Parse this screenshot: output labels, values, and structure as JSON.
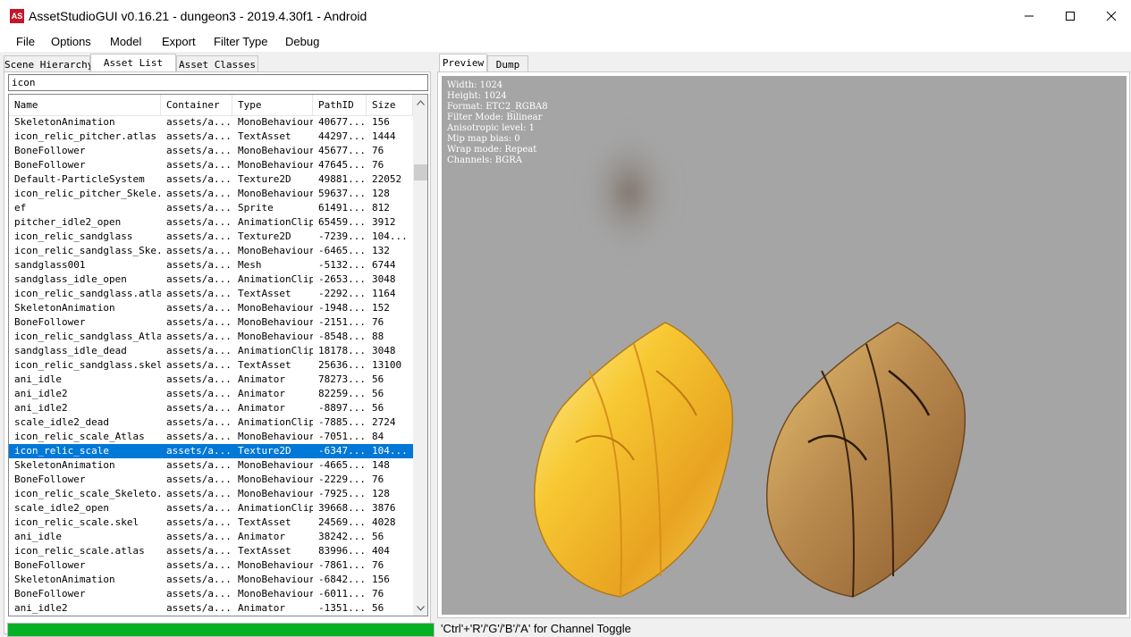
{
  "window": {
    "title": "AssetStudioGUI v0.16.21 - dungeon3 - 2019.4.30f1 - Android",
    "icon_text": "AS"
  },
  "menu": [
    "File",
    "Options",
    "Model",
    "Export",
    "Filter Type",
    "Debug"
  ],
  "left_tabs": [
    "Scene Hierarchy",
    "Asset List",
    "Asset Classes"
  ],
  "filter": {
    "value": "icon"
  },
  "columns": [
    "Name",
    "Container",
    "Type",
    "PathID",
    "Size"
  ],
  "rows": [
    [
      "SkeletonAnimation",
      "assets/a...",
      "MonoBehaviour",
      "40677...",
      "156"
    ],
    [
      "icon_relic_pitcher.atlas",
      "assets/a...",
      "TextAsset",
      "44297...",
      "1444"
    ],
    [
      "BoneFollower",
      "assets/a...",
      "MonoBehaviour",
      "45677...",
      "76"
    ],
    [
      "BoneFollower",
      "assets/a...",
      "MonoBehaviour",
      "47645...",
      "76"
    ],
    [
      "Default-ParticleSystem",
      "assets/a...",
      "Texture2D",
      "49881...",
      "22052"
    ],
    [
      "icon_relic_pitcher_Skele...",
      "assets/a...",
      "MonoBehaviour",
      "59637...",
      "128"
    ],
    [
      "ef",
      "assets/a...",
      "Sprite",
      "61491...",
      "812"
    ],
    [
      "pitcher_idle2_open",
      "assets/a...",
      "AnimationClip",
      "65459...",
      "3912"
    ],
    [
      "icon_relic_sandglass",
      "assets/a...",
      "Texture2D",
      "-7239...",
      "104..."
    ],
    [
      "icon_relic_sandglass_Ske...",
      "assets/a...",
      "MonoBehaviour",
      "-6465...",
      "132"
    ],
    [
      "sandglass001",
      "assets/a...",
      "Mesh",
      "-5132...",
      "6744"
    ],
    [
      "sandglass_idle_open",
      "assets/a...",
      "AnimationClip",
      "-2653...",
      "3048"
    ],
    [
      "icon_relic_sandglass.atlas",
      "assets/a...",
      "TextAsset",
      "-2292...",
      "1164"
    ],
    [
      "SkeletonAnimation",
      "assets/a...",
      "MonoBehaviour",
      "-1948...",
      "152"
    ],
    [
      "BoneFollower",
      "assets/a...",
      "MonoBehaviour",
      "-2151...",
      "76"
    ],
    [
      "icon_relic_sandglass_Atlas",
      "assets/a...",
      "MonoBehaviour",
      "-8548...",
      "88"
    ],
    [
      "sandglass_idle_dead",
      "assets/a...",
      "AnimationClip",
      "18178...",
      "3048"
    ],
    [
      "icon_relic_sandglass.skel",
      "assets/a...",
      "TextAsset",
      "25636...",
      "13100"
    ],
    [
      "ani_idle",
      "assets/a...",
      "Animator",
      "78273...",
      "56"
    ],
    [
      "ani_idle2",
      "assets/a...",
      "Animator",
      "82259...",
      "56"
    ],
    [
      "ani_idle2",
      "assets/a...",
      "Animator",
      "-8897...",
      "56"
    ],
    [
      "scale_idle2_dead",
      "assets/a...",
      "AnimationClip",
      "-7885...",
      "2724"
    ],
    [
      "icon_relic_scale_Atlas",
      "assets/a...",
      "MonoBehaviour",
      "-7051...",
      "84"
    ],
    [
      "icon_relic_scale",
      "assets/a...",
      "Texture2D",
      "-6347...",
      "104..."
    ],
    [
      "SkeletonAnimation",
      "assets/a...",
      "MonoBehaviour",
      "-4665...",
      "148"
    ],
    [
      "BoneFollower",
      "assets/a...",
      "MonoBehaviour",
      "-2229...",
      "76"
    ],
    [
      "icon_relic_scale_Skeleto...",
      "assets/a...",
      "MonoBehaviour",
      "-7925...",
      "128"
    ],
    [
      "scale_idle2_open",
      "assets/a...",
      "AnimationClip",
      "39668...",
      "3876"
    ],
    [
      "icon_relic_scale.skel",
      "assets/a...",
      "TextAsset",
      "24569...",
      "4028"
    ],
    [
      "ani_idle",
      "assets/a...",
      "Animator",
      "38242...",
      "56"
    ],
    [
      "icon_relic_scale.atlas",
      "assets/a...",
      "TextAsset",
      "83996...",
      "404"
    ],
    [
      "BoneFollower",
      "assets/a...",
      "MonoBehaviour",
      "-7861...",
      "76"
    ],
    [
      "SkeletonAnimation",
      "assets/a...",
      "MonoBehaviour",
      "-6842...",
      "156"
    ],
    [
      "BoneFollower",
      "assets/a...",
      "MonoBehaviour",
      "-6011...",
      "76"
    ],
    [
      "ani_idle2",
      "assets/a...",
      "Animator",
      "-1351...",
      "56"
    ]
  ],
  "selected_row": 23,
  "progress": 1.0,
  "right_tabs": [
    "Preview",
    "Dump"
  ],
  "texture_info": [
    "Width: 1024",
    "Height: 1024",
    "Format: ETC2_RGBA8",
    "Filter Mode: Bilinear",
    "Anisotropic level: 1",
    "Mip map bias: 0",
    "Wrap mode: Repeat",
    "Channels: BGRA"
  ],
  "status_text": "'Ctrl'+'R'/'G'/'B'/'A' for Channel Toggle",
  "colors": {
    "selection": "#0078d7",
    "progress": "#06b025",
    "preview_bg": "#a5a5a5",
    "gold_light": "#f7c832",
    "gold_dark": "#a86b2a",
    "app_icon": "#c4162a"
  },
  "icons": [
    "app-icon",
    "minimize-icon",
    "maximize-icon",
    "close-icon",
    "scroll-up-icon",
    "scroll-down-icon"
  ]
}
